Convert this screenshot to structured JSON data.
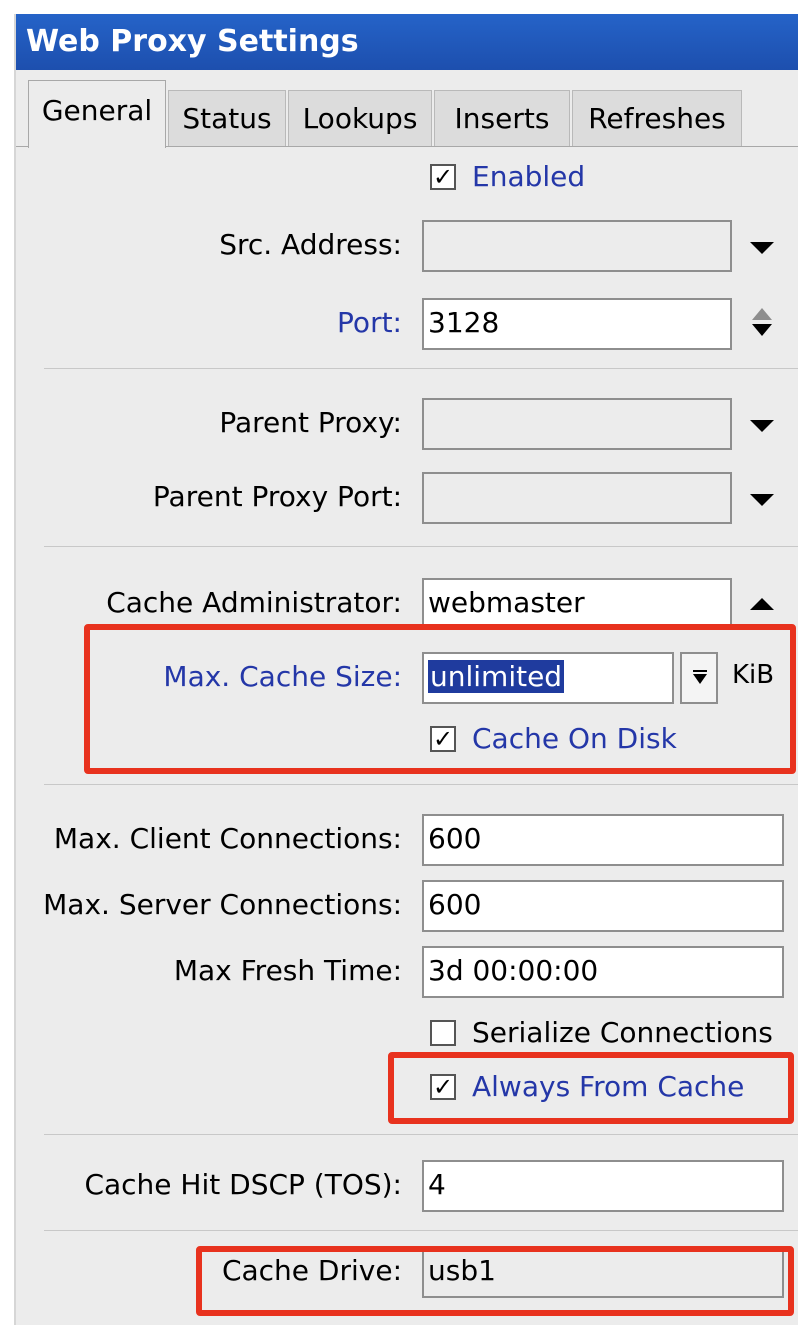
{
  "window": {
    "title": "Web Proxy Settings"
  },
  "tabs": [
    {
      "label": "General",
      "active": true
    },
    {
      "label": "Status"
    },
    {
      "label": "Lookups"
    },
    {
      "label": "Inserts"
    },
    {
      "label": "Refreshes"
    }
  ],
  "general": {
    "enabled": {
      "label": "Enabled",
      "checked": true
    },
    "src_address": {
      "label": "Src. Address:",
      "value": ""
    },
    "port": {
      "label": "Port:",
      "value": "3128"
    },
    "parent_proxy": {
      "label": "Parent Proxy:",
      "value": ""
    },
    "parent_proxy_port": {
      "label": "Parent Proxy Port:",
      "value": ""
    },
    "cache_administrator": {
      "label": "Cache Administrator:",
      "value": "webmaster"
    },
    "max_cache_size": {
      "label": "Max. Cache Size:",
      "value": "unlimited",
      "unit": "KiB"
    },
    "cache_on_disk": {
      "label": "Cache On Disk",
      "checked": true
    },
    "max_client_connections": {
      "label": "Max. Client Connections:",
      "value": "600"
    },
    "max_server_connections": {
      "label": "Max. Server Connections:",
      "value": "600"
    },
    "max_fresh_time": {
      "label": "Max Fresh Time:",
      "value": "3d 00:00:00"
    },
    "serialize_connections": {
      "label": "Serialize Connections",
      "checked": false
    },
    "always_from_cache": {
      "label": "Always From Cache",
      "checked": true
    },
    "cache_hit_dscp": {
      "label": "Cache Hit DSCP (TOS):",
      "value": "4"
    },
    "cache_drive": {
      "label": "Cache Drive:",
      "value": "usb1"
    }
  },
  "colors": {
    "title_bar": "#1d4fae",
    "link_label": "#2437a8",
    "highlight": "#e8321e"
  }
}
